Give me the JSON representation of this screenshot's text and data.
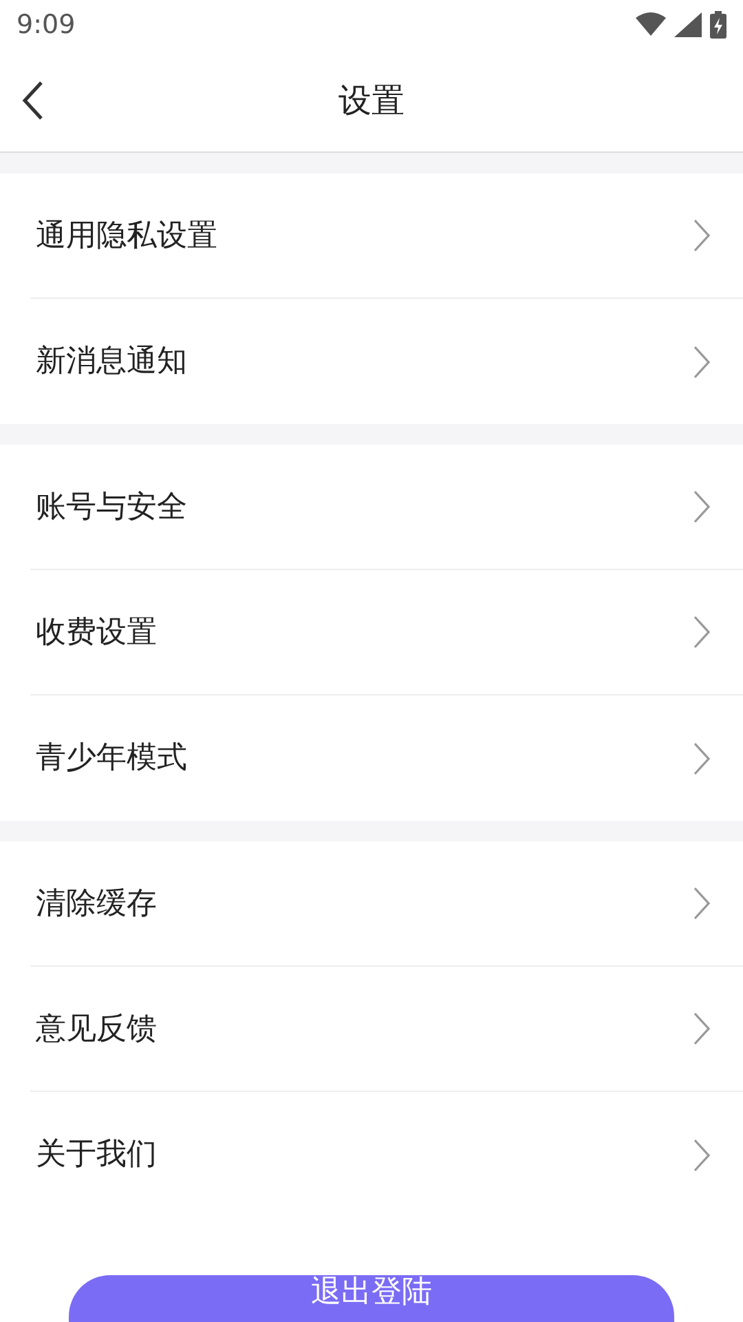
{
  "status_bar": {
    "time": "9:09"
  },
  "header": {
    "title": "设置"
  },
  "groups": [
    {
      "items": [
        {
          "label": "通用隐私设置"
        },
        {
          "label": "新消息通知"
        }
      ]
    },
    {
      "items": [
        {
          "label": "账号与安全"
        },
        {
          "label": "收费设置"
        },
        {
          "label": "青少年模式"
        }
      ]
    },
    {
      "items": [
        {
          "label": "清除缓存"
        },
        {
          "label": "意见反馈"
        },
        {
          "label": "关于我们"
        }
      ]
    }
  ],
  "logout_button": {
    "label": "退出登陆"
  }
}
